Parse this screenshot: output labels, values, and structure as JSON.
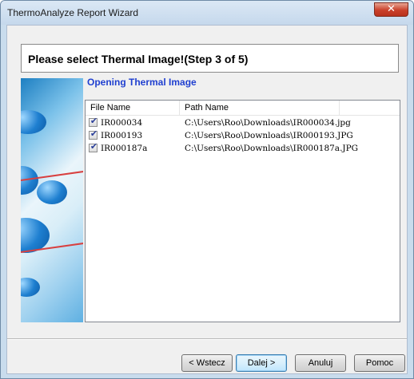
{
  "window": {
    "title": "ThermoAnalyze Report Wizard",
    "close_label": "✕"
  },
  "header": {
    "text": "Please select Thermal Image!(Step 3 of 5)"
  },
  "section": {
    "title": "Opening Thermal Image"
  },
  "list": {
    "columns": [
      "File Name",
      "Path Name"
    ],
    "rows": [
      {
        "checked": true,
        "name": "IR000034",
        "path": "C:\\Users\\Roo\\Downloads\\IR000034.jpg"
      },
      {
        "checked": true,
        "name": "IR000193",
        "path": "C:\\Users\\Roo\\Downloads\\IR000193.JPG"
      },
      {
        "checked": true,
        "name": "IR000187a",
        "path": "C:\\Users\\Roo\\Downloads\\IR000187a.JPG"
      }
    ]
  },
  "buttons": {
    "back": "< Wstecz",
    "next": "Dalej >",
    "cancel": "Anuluj",
    "help": "Pomoc"
  },
  "colors": {
    "title_accent": "#1f3fd0",
    "close_red": "#c9402a"
  }
}
